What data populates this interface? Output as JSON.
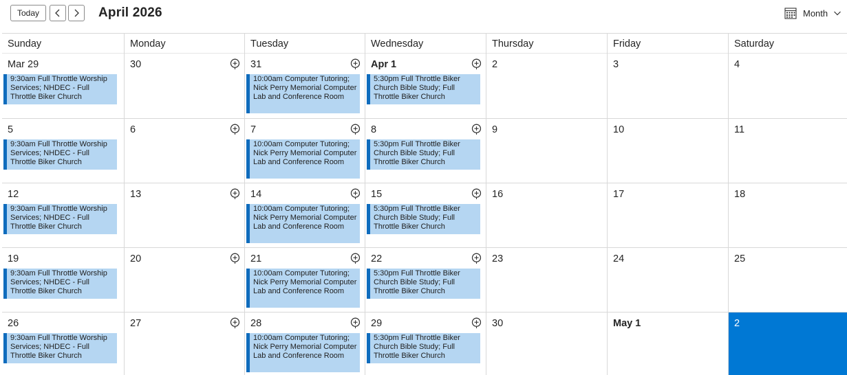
{
  "toolbar": {
    "today_label": "Today",
    "prev_icon": "chevron-left-icon",
    "next_icon": "chevron-right-icon",
    "title": "April 2026",
    "view_label": "Month",
    "view_icon": "calendar-grid-icon",
    "view_chevron_icon": "chevron-down-icon"
  },
  "colors": {
    "event_bg": "#b5d6f2",
    "event_border": "#0f6cbd",
    "selected": "#0078d4"
  },
  "weekdays": [
    "Sunday",
    "Monday",
    "Tuesday",
    "Wednesday",
    "Thursday",
    "Friday",
    "Saturday"
  ],
  "weeks": [
    [
      {
        "label": "Mar 29",
        "bold": false,
        "event": "9:30am Full Throttle Worship Services; NHDEC - Full Throttle Biker Church"
      },
      {
        "label": "30",
        "add": true
      },
      {
        "label": "31",
        "add": true,
        "event": "10:00am Computer Tutoring; Nick Perry Memorial Computer Lab and Conference Room"
      },
      {
        "label": "Apr 1",
        "bold": true,
        "add": true,
        "event": "5:30pm Full Throttle Biker Church Bible Study; Full Throttle Biker Church"
      },
      {
        "label": "2"
      },
      {
        "label": "3"
      },
      {
        "label": "4"
      }
    ],
    [
      {
        "label": "5",
        "event": "9:30am Full Throttle Worship Services; NHDEC - Full Throttle Biker Church"
      },
      {
        "label": "6",
        "add": true
      },
      {
        "label": "7",
        "add": true,
        "event": "10:00am Computer Tutoring; Nick Perry Memorial Computer Lab and Conference Room"
      },
      {
        "label": "8",
        "add": true,
        "event": "5:30pm Full Throttle Biker Church Bible Study; Full Throttle Biker Church"
      },
      {
        "label": "9"
      },
      {
        "label": "10"
      },
      {
        "label": "11"
      }
    ],
    [
      {
        "label": "12",
        "event": "9:30am Full Throttle Worship Services; NHDEC - Full Throttle Biker Church"
      },
      {
        "label": "13",
        "add": true
      },
      {
        "label": "14",
        "add": true,
        "event": "10:00am Computer Tutoring; Nick Perry Memorial Computer Lab and Conference Room"
      },
      {
        "label": "15",
        "add": true,
        "event": "5:30pm Full Throttle Biker Church Bible Study; Full Throttle Biker Church"
      },
      {
        "label": "16"
      },
      {
        "label": "17"
      },
      {
        "label": "18"
      }
    ],
    [
      {
        "label": "19",
        "event": "9:30am Full Throttle Worship Services; NHDEC - Full Throttle Biker Church"
      },
      {
        "label": "20",
        "add": true
      },
      {
        "label": "21",
        "add": true,
        "event": "10:00am Computer Tutoring; Nick Perry Memorial Computer Lab and Conference Room"
      },
      {
        "label": "22",
        "add": true,
        "event": "5:30pm Full Throttle Biker Church Bible Study; Full Throttle Biker Church"
      },
      {
        "label": "23"
      },
      {
        "label": "24"
      },
      {
        "label": "25"
      }
    ],
    [
      {
        "label": "26",
        "event": "9:30am Full Throttle Worship Services; NHDEC - Full Throttle Biker Church"
      },
      {
        "label": "27",
        "add": true
      },
      {
        "label": "28",
        "add": true,
        "event": "10:00am Computer Tutoring; Nick Perry Memorial Computer Lab and Conference Room"
      },
      {
        "label": "29",
        "add": true,
        "event": "5:30pm Full Throttle Biker Church Bible Study; Full Throttle Biker Church"
      },
      {
        "label": "30"
      },
      {
        "label": "May 1",
        "bold": true
      },
      {
        "label": "2",
        "selected": true
      }
    ]
  ]
}
